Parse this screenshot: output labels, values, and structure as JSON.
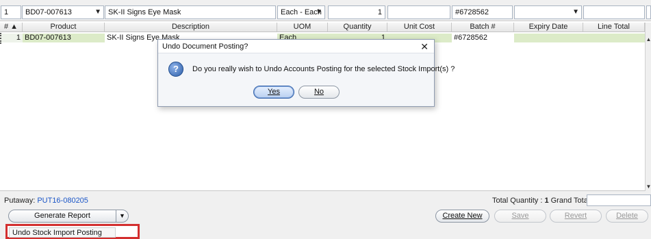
{
  "edit_row": {
    "line_no": "1",
    "product": "BD07-007613",
    "description": "SK-II Signs Eye Mask",
    "uom": "Each - Each",
    "quantity": "1",
    "unit_cost": "",
    "batch": "#6728562",
    "expiry": "",
    "line_total": ""
  },
  "grid": {
    "columns": [
      "# ▲",
      "Product",
      "Description",
      "UOM",
      "Quantity",
      "Unit Cost",
      "Batch #",
      "Expiry Date",
      "Line Total"
    ],
    "rows": [
      {
        "num": "1",
        "product": "BD07-007613",
        "description": "SK-II Signs Eye Mask",
        "uom": "Each",
        "quantity": "1",
        "unit_cost": "",
        "batch": "#6728562",
        "expiry": "",
        "line_total": ""
      }
    ]
  },
  "footer": {
    "putaway_label": "Putaway:",
    "putaway_ref": "PUT16-080205",
    "total_qty_label": "Total Quantity :",
    "total_qty_value": "1",
    "grand_total_label": "Grand Total:",
    "grand_total_value": ""
  },
  "buttons": {
    "generate_report": "Generate Report",
    "create_new": "Create New",
    "save": "Save",
    "revert": "Revert",
    "delete": "Delete"
  },
  "menu": {
    "undo_posting": "Undo Stock Import Posting"
  },
  "dialog": {
    "title": "Undo Document Posting?",
    "message": "Do you really wish to Undo Accounts Posting for the selected Stock Import(s) ?",
    "yes": "Yes",
    "no": "No",
    "icon": "question-icon"
  },
  "colors": {
    "link": "#1a55c7",
    "row_highlight": "#dcebc8",
    "highlight_box": "#d32f2f"
  }
}
